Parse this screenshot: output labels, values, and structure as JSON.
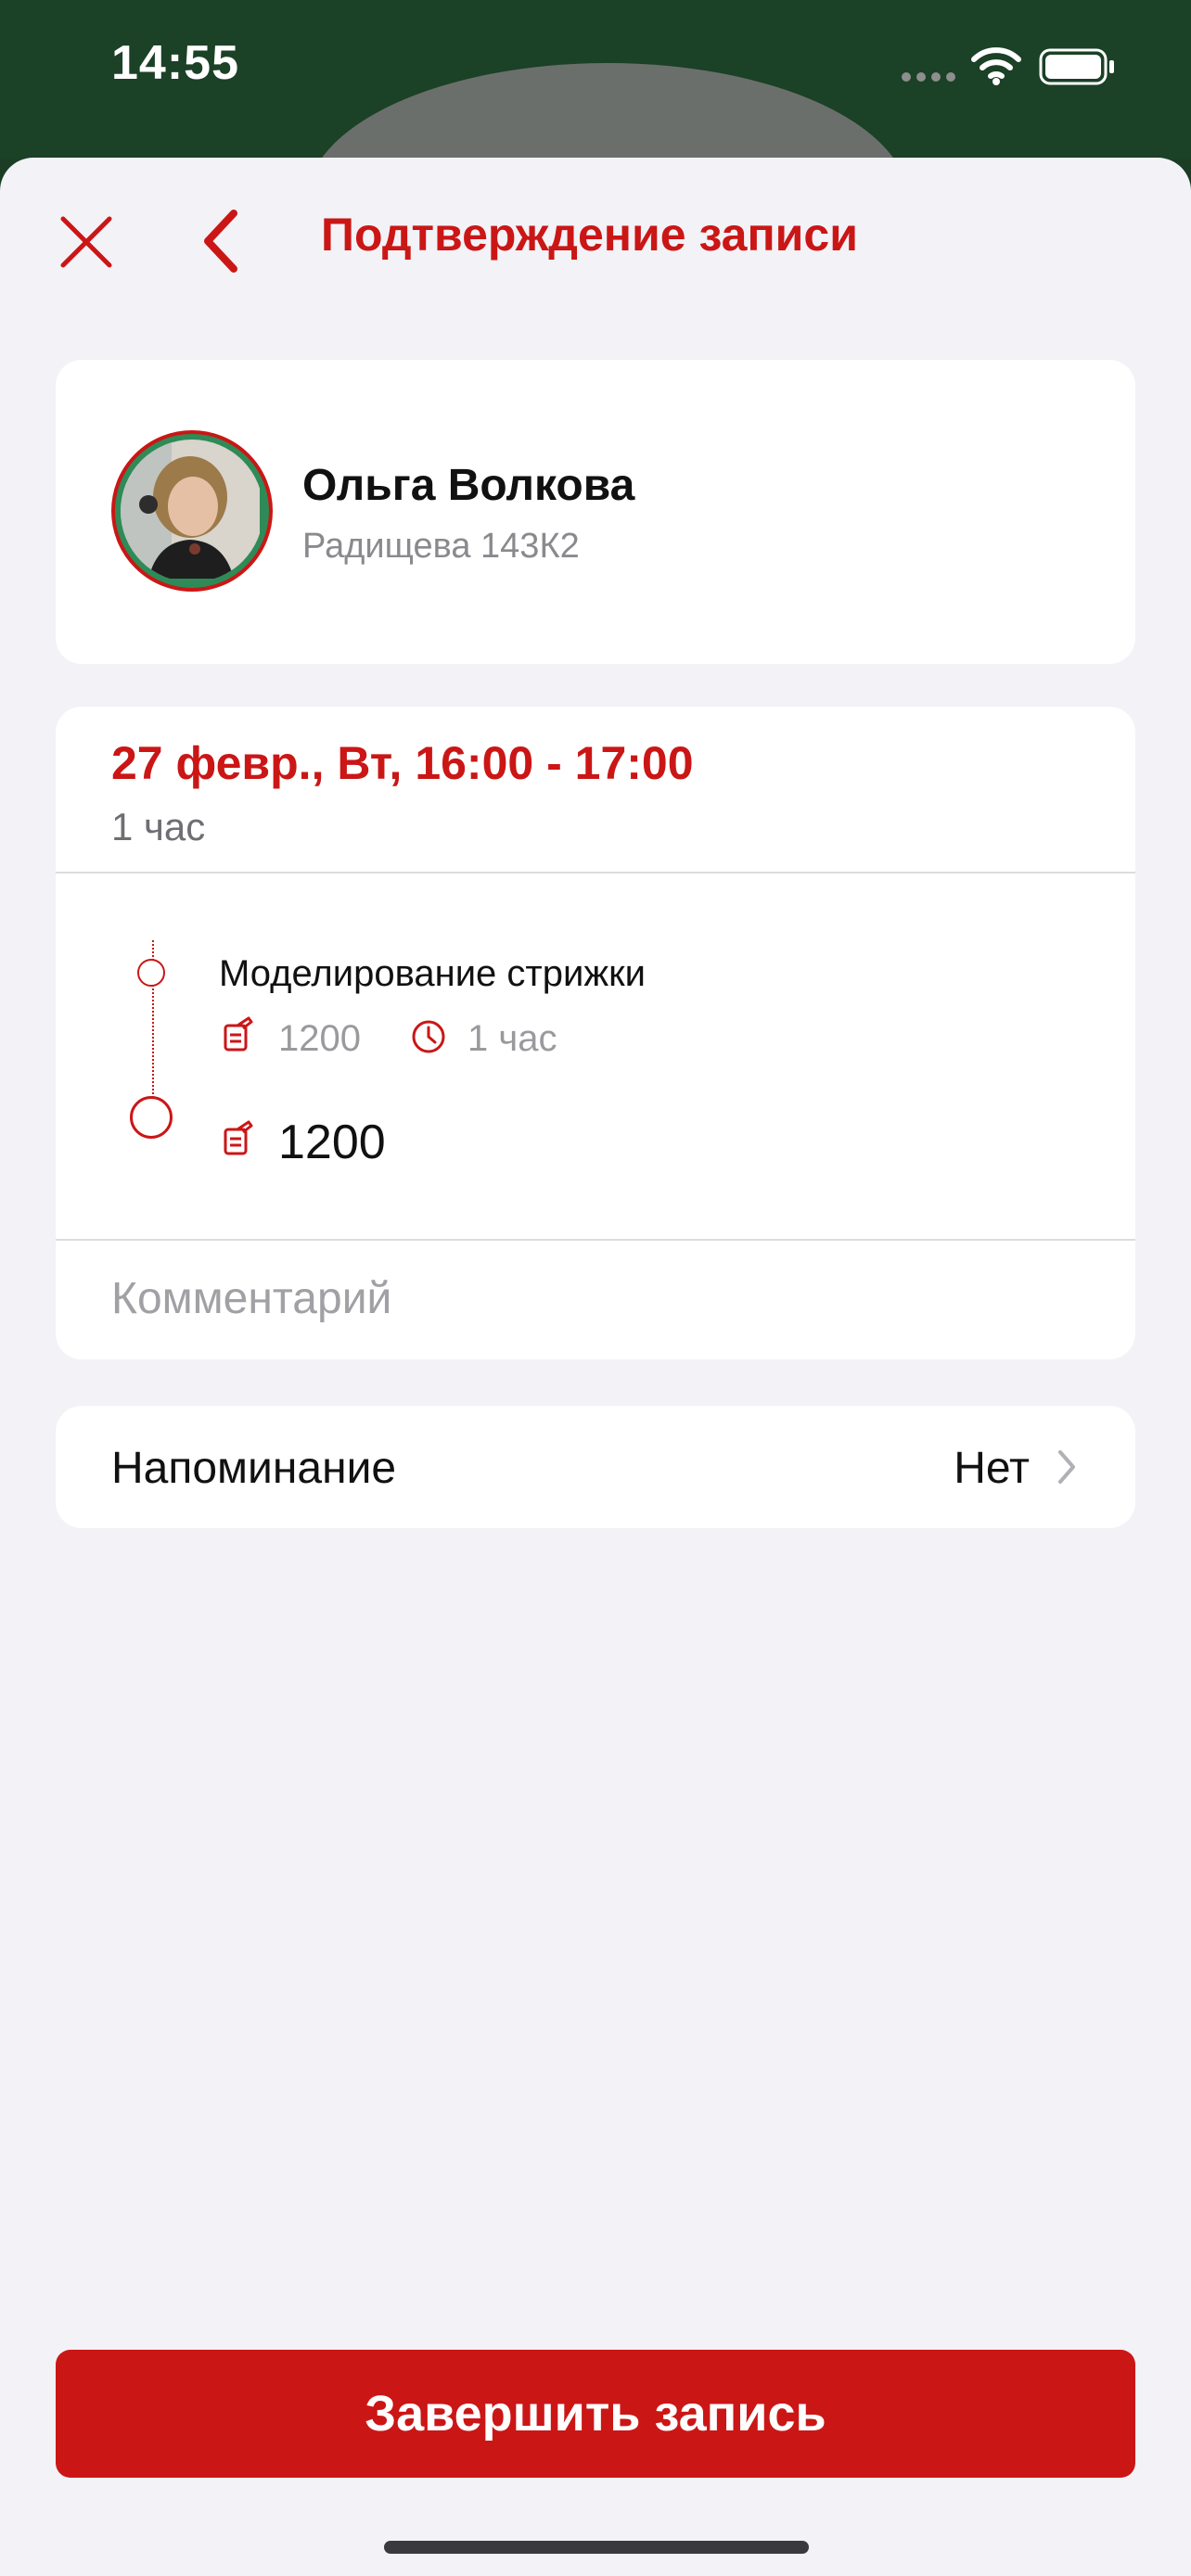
{
  "status_bar": {
    "time": "14:55"
  },
  "header": {
    "title": "Подтверждение записи"
  },
  "master": {
    "name": "Ольга Волкова",
    "address": "Радищева 143К2"
  },
  "booking": {
    "datetime": "27 февр., Вт, 16:00 - 17:00",
    "duration": "1 час",
    "services": [
      {
        "name": "Моделирование стрижки",
        "price": "1200",
        "duration": "1 час"
      }
    ],
    "total_price": "1200",
    "comment_placeholder": "Комментарий"
  },
  "reminder": {
    "label": "Напоминание",
    "value": "Нет"
  },
  "footer": {
    "finish_label": "Завершить запись"
  },
  "colors": {
    "accent": "#cb1616",
    "background": "#f2f2f7",
    "status_bar": "#1b4127"
  }
}
